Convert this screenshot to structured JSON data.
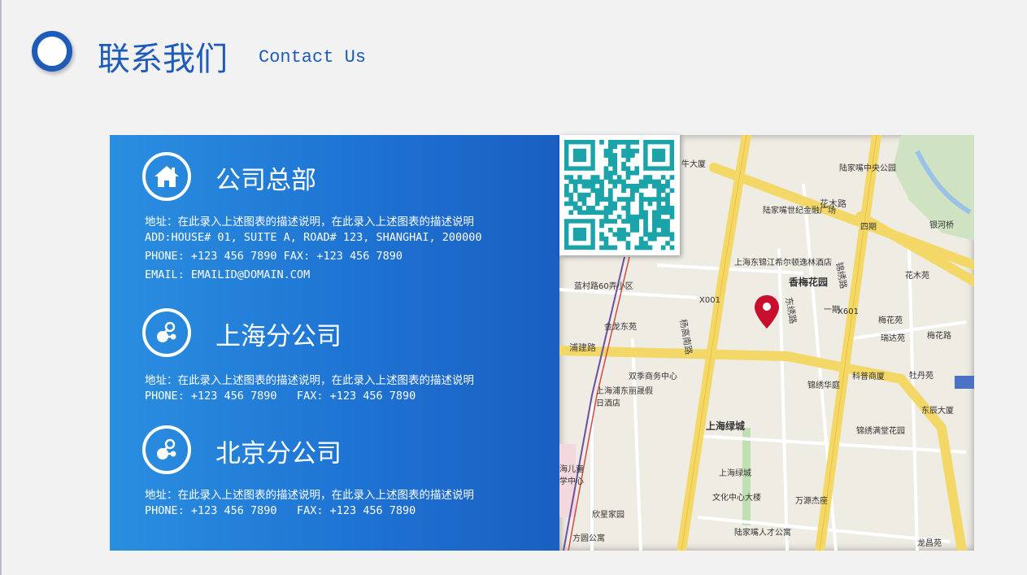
{
  "header": {
    "title_cn": "联系我们",
    "title_en": "Contact Us"
  },
  "sections": [
    {
      "icon": "home-icon",
      "title": "公司总部",
      "lines": [
        "地址：在此录入上述图表的描述说明，在此录入上述图表的描述说明",
        "ADD:HOUSE# 01, SUITE A, ROAD# 123, SHANGHAI, 200000",
        "PHONE: +123 456 7890 FAX: +123 456 7890",
        "EMAIL: EMAILID@DOMAIN.COM"
      ]
    },
    {
      "icon": "molecule-icon",
      "title": "上海分公司",
      "lines": [
        "地址：在此录入上述图表的描述说明，在此录入上述图表的描述说明",
        "PHONE: +123 456 7890   FAX: +123 456 7890"
      ]
    },
    {
      "icon": "molecule-icon",
      "title": "北京分公司",
      "lines": [
        "地址：在此录入上述图表的描述说明，在此录入上述图表的描述说明",
        "PHONE: +123 456 7890   FAX: +123 456 7890"
      ]
    }
  ],
  "map": {
    "labels": [
      "陆家嘴中央公园",
      "牛大厦",
      "陆家嘴世纪金融广场",
      "花木路",
      "四期",
      "银河桥",
      "上海东锦江希尔顿逸林酒店",
      "香梅花园",
      "花木苑",
      "蓝村路60弄小区",
      "一期",
      "梅花苑",
      "金龙东苑",
      "瑞达苑",
      "梅花路",
      "浦建路",
      "双季商务中心",
      "科普商厦",
      "牡丹苑",
      "上海浦东丽晟假日酒店",
      "锦绣华庭",
      "东辰大厦",
      "上海绿城",
      "锦绣满堂花园",
      "海儿童学中心",
      "上海绿城",
      "文化中心大楼",
      "万源杰座",
      "欣星家园",
      "陆家嘴人才公寓",
      "方圆公寓",
      "龙昌苑",
      "杨高南路",
      "锦绣路",
      "东绣路",
      "X001",
      "X601"
    ],
    "pin_color": "#c8102e"
  },
  "colors": {
    "accent": "#1f5bb8",
    "panel": "#1e73d2",
    "qr": "#1aa3a8"
  }
}
